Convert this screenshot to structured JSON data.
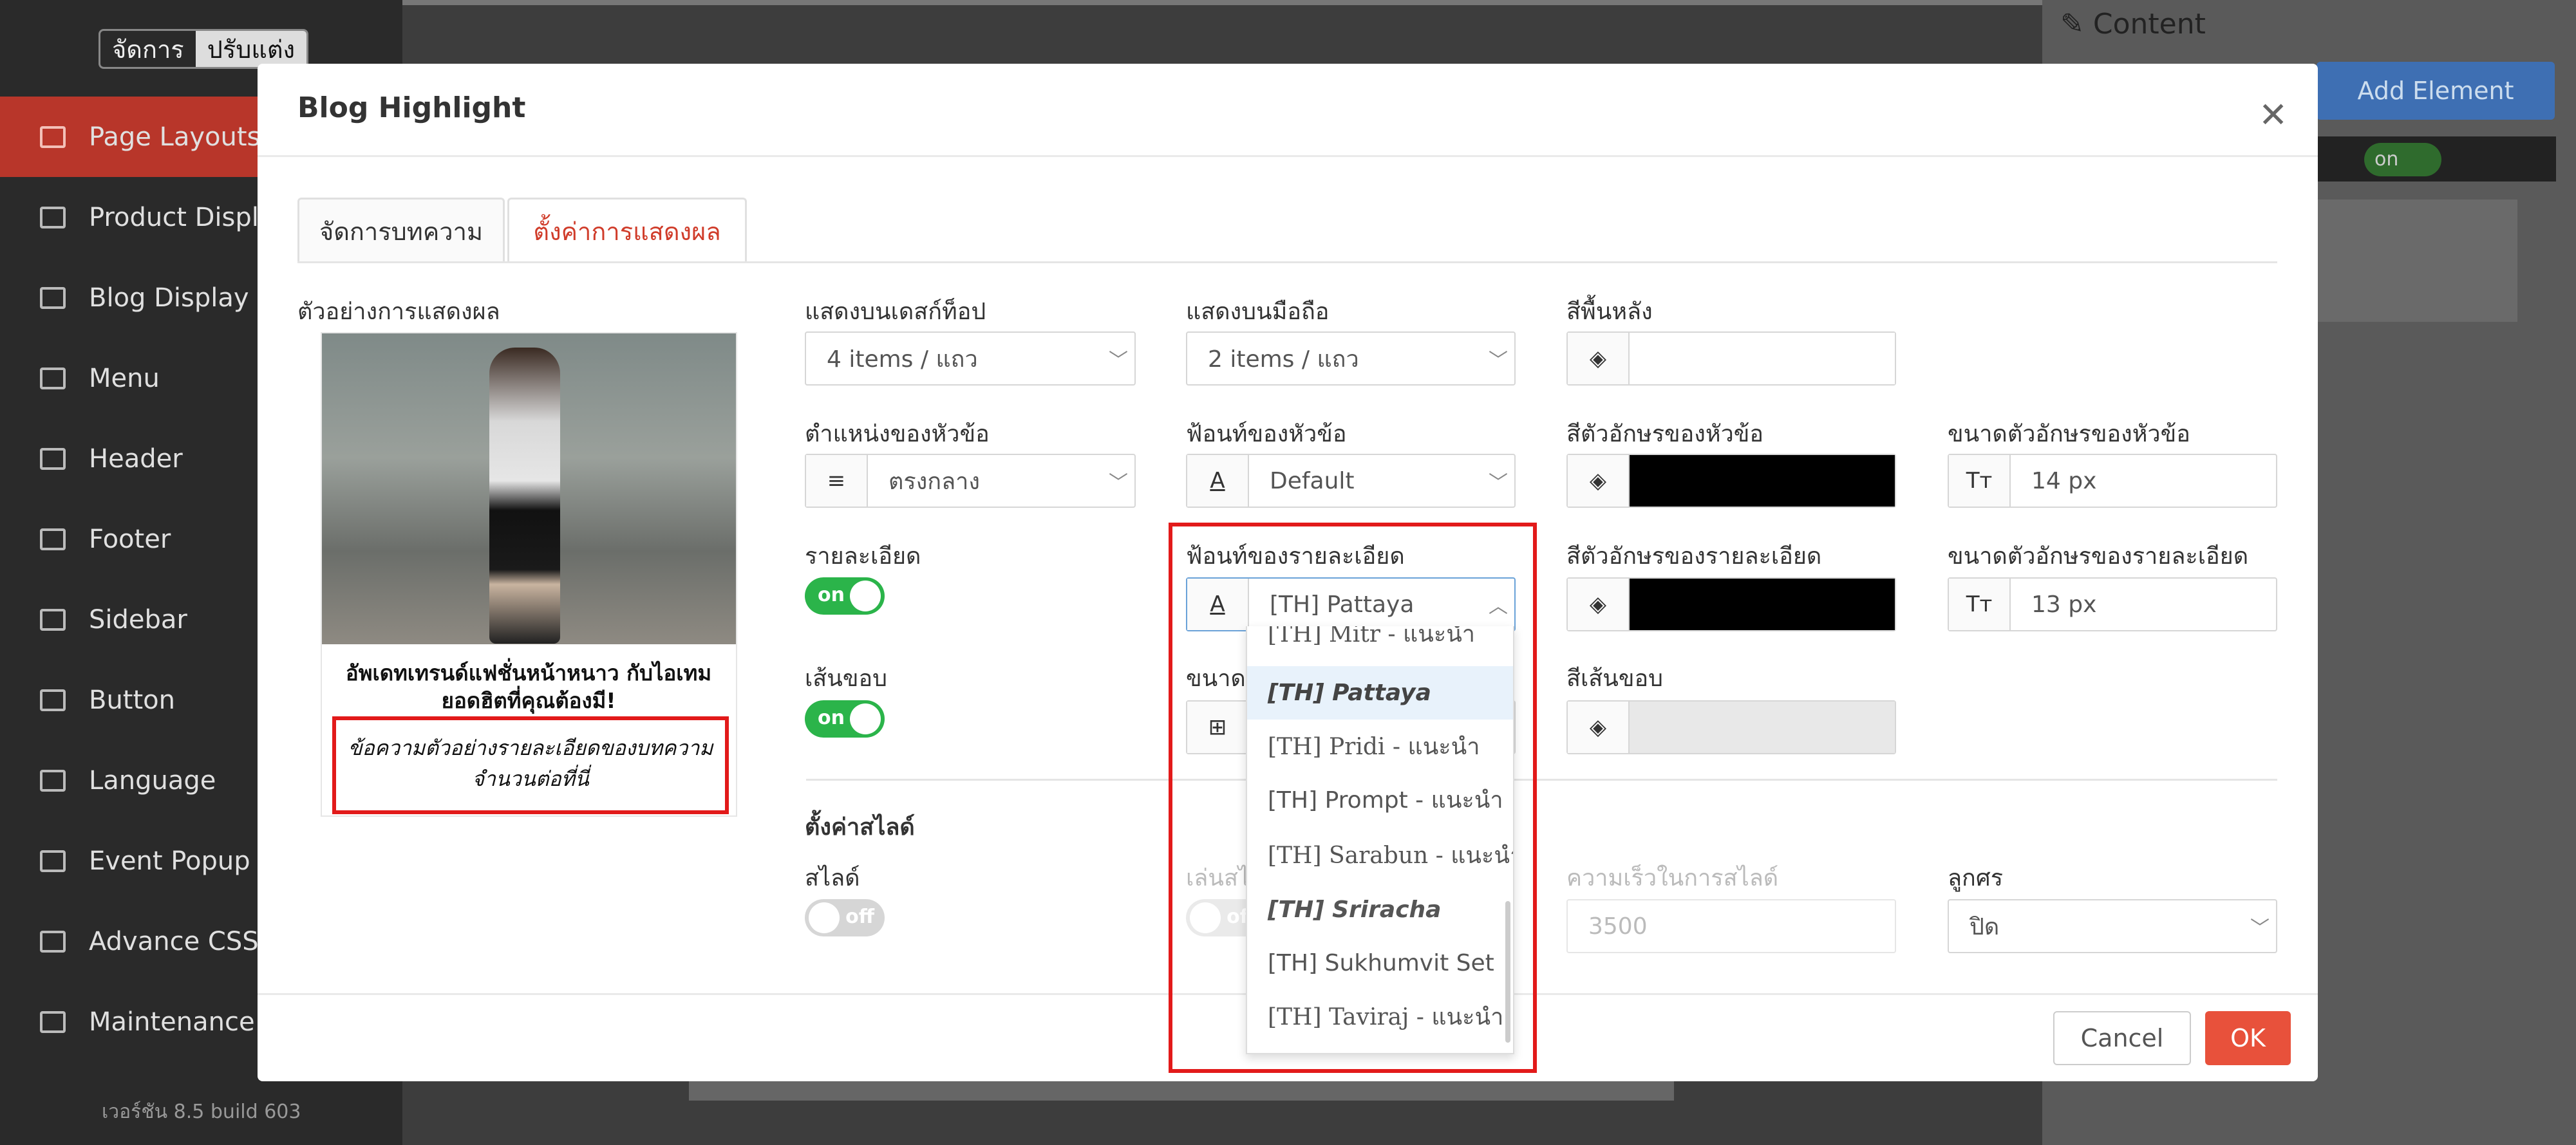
{
  "sidebar": {
    "mode_manage": "จัดการ",
    "mode_customize": "ปรับแต่ง",
    "items": [
      {
        "label": "Page Layouts"
      },
      {
        "label": "Product Display"
      },
      {
        "label": "Blog Display"
      },
      {
        "label": "Menu"
      },
      {
        "label": "Header"
      },
      {
        "label": "Footer"
      },
      {
        "label": "Sidebar"
      },
      {
        "label": "Button"
      },
      {
        "label": "Language"
      },
      {
        "label": "Event Popup"
      },
      {
        "label": "Advance CSS"
      },
      {
        "label": "Maintenance"
      }
    ],
    "version": "เวอร์ชัน 8.5 build 603"
  },
  "right_panel": {
    "title": "Content",
    "add_element": "Add Element",
    "toggle": "on"
  },
  "modal": {
    "title": "Blog Highlight",
    "tabs": [
      "จัดการบทความ",
      "ตั้งค่าการแสดงผล"
    ],
    "active_tab": 1,
    "preview": {
      "label": "ตัวอย่างการแสดงผล",
      "title": "อัพเดทเทรนด์แฟชั่นหน้าหนาว กับไอเทมยอดฮิตที่คุณต้องมี!",
      "description": "ข้อความตัวอย่างรายละเอียดของบทความ จำนวนต่อที่นี่"
    },
    "desktop": {
      "label": "แสดงบนเดสก์ท็อป",
      "value": "4 items / แถว"
    },
    "mobile": {
      "label": "แสดงบนมือถือ",
      "value": "2 items / แถว"
    },
    "bg_color": {
      "label": "สีพื้นหลัง",
      "value": ""
    },
    "title_position": {
      "label": "ตำแหน่งของหัวข้อ",
      "value": "ตรงกลาง"
    },
    "title_font": {
      "label": "ฟ้อนท์ของหัวข้อ",
      "value": "Default"
    },
    "title_color": {
      "label": "สีตัวอักษรของหัวข้อ",
      "value": "#000000"
    },
    "title_size": {
      "label": "ขนาดตัวอักษรของหัวข้อ",
      "value": "14 px"
    },
    "detail": {
      "label": "รายละเอียด",
      "state": "on"
    },
    "detail_font": {
      "label": "ฟ้อนท์ของรายละเอียด",
      "value": "[TH] Pattaya",
      "options": [
        "[TH] Mitr - แนะนำ",
        "[TH] Pattaya",
        "[TH] Pridi - แนะนำ",
        "[TH] Prompt - แนะนำ",
        "[TH] Sarabun - แนะนำ",
        "[TH] Sriracha",
        "[TH] Sukhumvit Set",
        "[TH] Taviraj - แนะนำ"
      ]
    },
    "detail_color": {
      "label": "สีตัวอักษรของรายละเอียด",
      "value": "#000000"
    },
    "detail_size": {
      "label": "ขนาดตัวอักษรของรายละเอียด",
      "value": "13 px"
    },
    "border": {
      "label": "เส้นขอบ",
      "state": "on"
    },
    "border_size": {
      "label": "ขนาดเ"
    },
    "border_color": {
      "label": "สีเส้นขอบ",
      "value": "#e8e8e8"
    },
    "slide_section": "ตั้งค่าสไลด์",
    "slide": {
      "label": "สไลด์",
      "state": "off"
    },
    "autoplay": {
      "label": "เล่นสไ",
      "state": "off"
    },
    "slide_speed": {
      "label": "ความเร็วในการสไลด์",
      "placeholder": "3500"
    },
    "arrows": {
      "label": "ลูกศร",
      "value": "ปิด"
    },
    "cancel": "Cancel",
    "ok": "OK"
  }
}
